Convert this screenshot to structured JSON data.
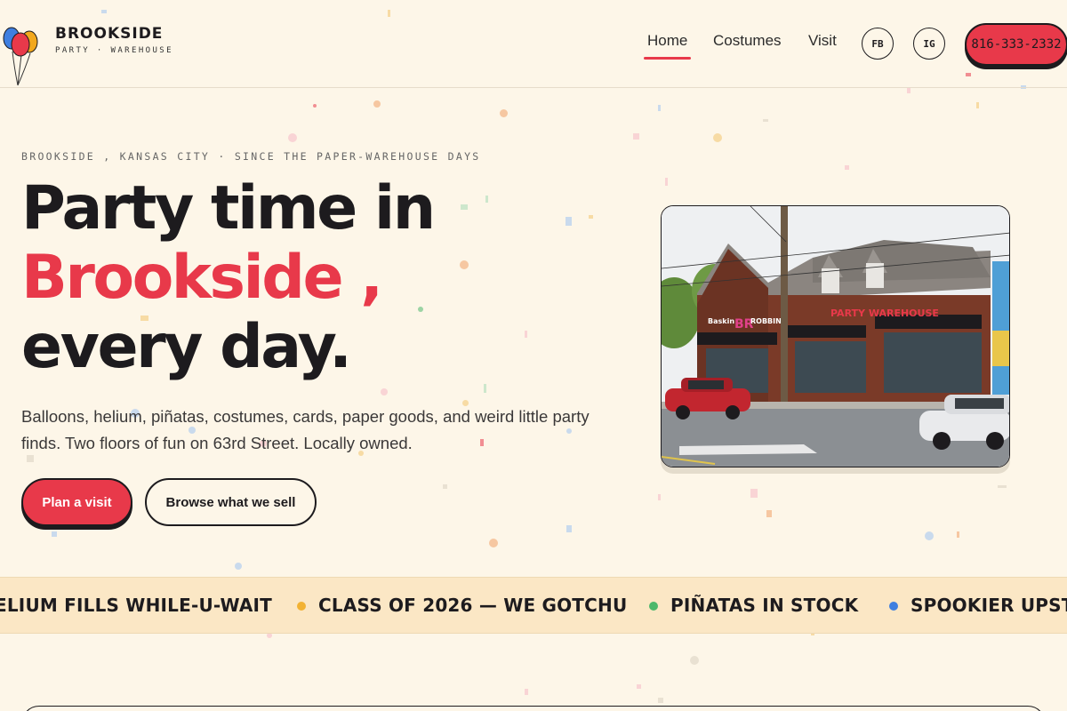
{
  "brand": {
    "name": "BROOKSIDE",
    "tagline": "PARTY · WAREHOUSE",
    "balloon_colors": [
      "#3f7fe0",
      "#f2a81d",
      "#e8394a"
    ]
  },
  "nav": {
    "items": [
      {
        "label": "Home",
        "active": true
      },
      {
        "label": "Costumes",
        "active": false
      },
      {
        "label": "Visit",
        "active": false
      }
    ],
    "social": [
      {
        "label": "FB",
        "icon": "facebook-icon"
      },
      {
        "label": "IG",
        "icon": "instagram-icon"
      }
    ],
    "phone": "816-333-2332"
  },
  "hero": {
    "eyebrow": "BROOKSIDE , KANSAS CITY · SINCE THE PAPER-WAREHOUSE DAYS",
    "headline_line1": "Party time in",
    "headline_accent": "Brookside ,",
    "headline_line3": "every day.",
    "lede": "Balloons, helium, piñatas, costumes, cards, paper goods, and weird little party finds. Two floors of fun on 63rd Street. Locally owned.",
    "primary_cta": "Plan a visit",
    "secondary_cta": "Browse what we sell"
  },
  "storefront": {
    "signs": [
      "Baskin",
      "BR",
      "ROBBINS",
      "PARTY WAREHOUSE"
    ]
  },
  "ticker": {
    "items": [
      {
        "text": "ELIUM FILLS WHILE-U-WAIT",
        "dot_color": ""
      },
      {
        "text": "CLASS OF 2026 — WE GOTCHU",
        "dot_color": "#f2b233"
      },
      {
        "text": "PIÑATAS IN STOCK",
        "dot_color": "#4cb86b"
      },
      {
        "text": "SPOOKIER UPSTA",
        "dot_color": "#3f7fe0"
      }
    ]
  },
  "colors": {
    "accent": "#e8394a",
    "background": "#fdf6e8",
    "ink": "#1d1b1e",
    "ticker_bg": "#fbe7c5"
  }
}
